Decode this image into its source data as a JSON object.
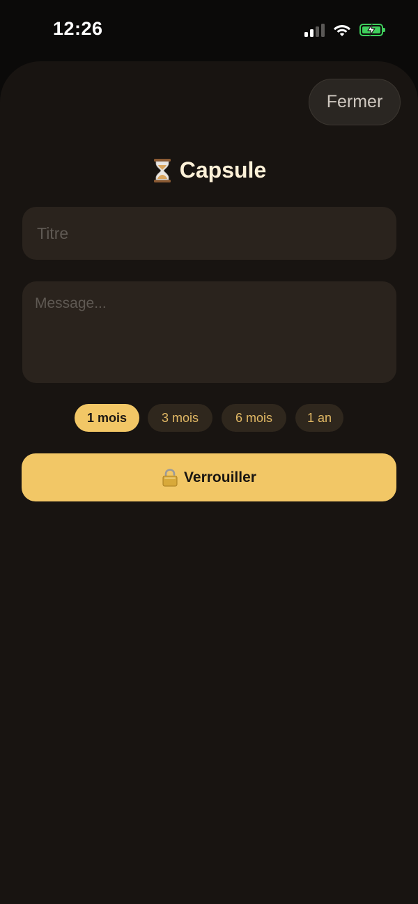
{
  "status_bar": {
    "time": "12:26"
  },
  "header": {
    "close_label": "Fermer",
    "title_icon": "hourglass-icon",
    "title": "Capsule"
  },
  "form": {
    "title_placeholder": "Titre",
    "title_value": "",
    "message_placeholder": "Message...",
    "message_value": ""
  },
  "durations": {
    "options": [
      "1 mois",
      "3 mois",
      "6 mois",
      "1 an"
    ],
    "selected": "1 mois"
  },
  "submit": {
    "icon": "lock-icon",
    "label": "Verrouiller"
  },
  "colors": {
    "background": "#181411",
    "accent": "#f2c766",
    "chip_inactive": "#2f271d",
    "field_bg": "#2a231d",
    "title_text": "#fdf1d8",
    "battery": "#3fcf5c"
  }
}
